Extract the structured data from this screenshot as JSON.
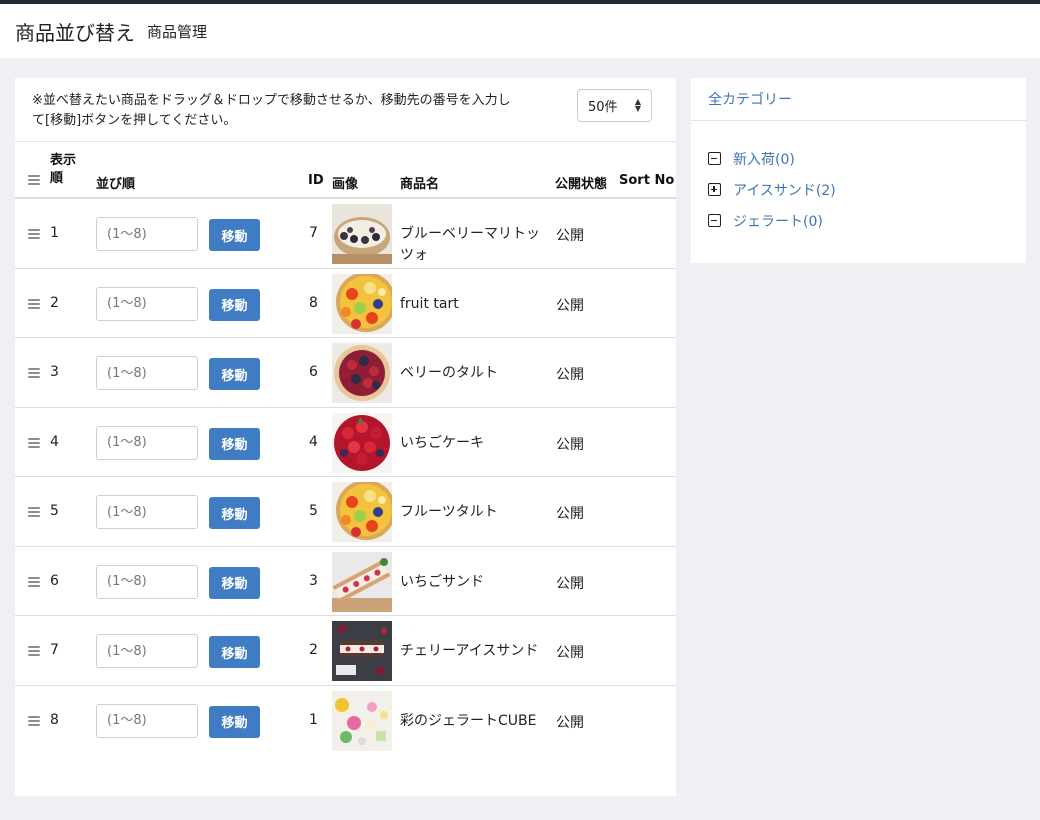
{
  "header": {
    "title": "商品並び替え",
    "subtitle": "商品管理"
  },
  "instructions": "※並べ替えたい商品をドラッグ＆ドロップで移動させるか、移動先の番号を入力して[移動]ボタンを押してください。",
  "per_page": {
    "selected": "50件"
  },
  "table": {
    "headers": {
      "display_order": "表示順",
      "sort_order": "並び順",
      "id": "ID",
      "image": "画像",
      "name": "商品名",
      "status": "公開状態",
      "sort_no": "Sort No"
    },
    "input_placeholder": "(1〜8)",
    "move_label": "移動",
    "rows": [
      {
        "num": "1",
        "id": "7",
        "name": "ブルーベリーマリトッツォ",
        "status": "公開",
        "thumb": "maritozzo"
      },
      {
        "num": "2",
        "id": "8",
        "name": "fruit tart",
        "status": "公開",
        "thumb": "fruit-tart"
      },
      {
        "num": "3",
        "id": "6",
        "name": "ベリーのタルト",
        "status": "公開",
        "thumb": "berry-tart"
      },
      {
        "num": "4",
        "id": "4",
        "name": "いちごケーキ",
        "status": "公開",
        "thumb": "strawberry-cake"
      },
      {
        "num": "5",
        "id": "5",
        "name": "フルーツタルト",
        "status": "公開",
        "thumb": "fruit-tart"
      },
      {
        "num": "6",
        "id": "3",
        "name": "いちごサンド",
        "status": "公開",
        "thumb": "strawberry-sand"
      },
      {
        "num": "7",
        "id": "2",
        "name": "チェリーアイスサンド",
        "status": "公開",
        "thumb": "cherry-ice-sand"
      },
      {
        "num": "8",
        "id": "1",
        "name": "彩のジェラートCUBE",
        "status": "公開",
        "thumb": "gelato-cube"
      }
    ]
  },
  "sidebar": {
    "title": "全カテゴリー",
    "categories": [
      {
        "label": "新入荷(0)",
        "icon": "minus-square-icon"
      },
      {
        "label": "アイスサンド(2)",
        "icon": "plus-square-icon"
      },
      {
        "label": "ジェラート(0)",
        "icon": "minus-square-icon"
      }
    ]
  },
  "colors": {
    "accent": "#3f7cc4",
    "link": "#3e76b5",
    "background": "#eff0f4",
    "topbar": "#222a35"
  }
}
